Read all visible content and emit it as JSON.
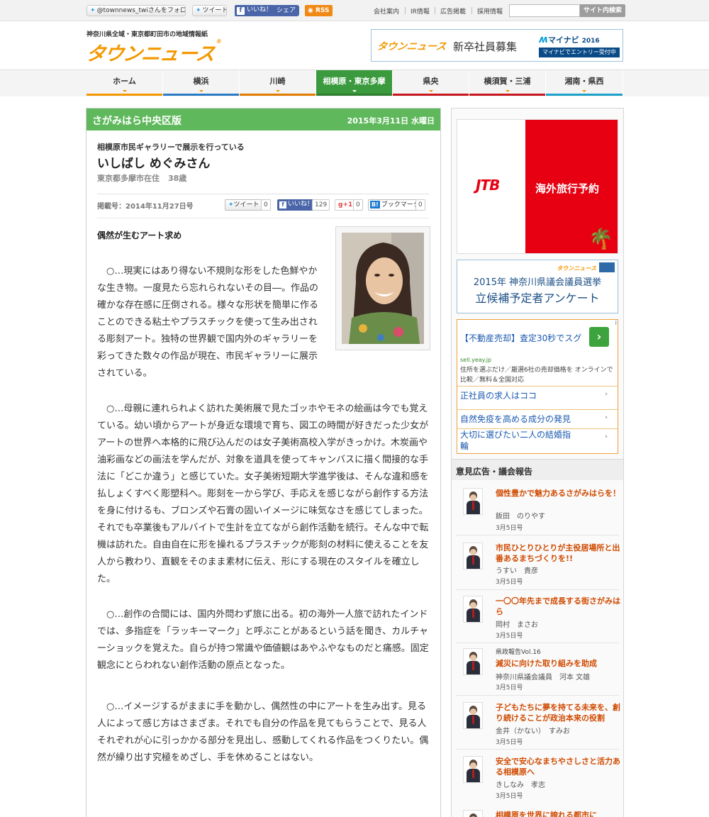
{
  "topbar": {
    "twitter_follow": "@townnews_twiさんをフォロー",
    "tweet": "ツイート",
    "like": "いいね！",
    "share": "シェア",
    "rss": "RSS",
    "links": [
      "会社案内",
      "IR情報",
      "広告掲載",
      "採用情報"
    ],
    "search_placeholder": "",
    "search_button": "サイト内検索"
  },
  "header": {
    "tagline": "神奈川県全域・東京都町田市の地域情報紙",
    "logo_text": "タウンニュース",
    "banner": {
      "logo": "タウンニュース",
      "text": "新卒社員募集",
      "mynavi": "マイナビ",
      "mynavi_year": "2016",
      "entry": "マイナビでエントリー受付中"
    }
  },
  "nav": {
    "items": [
      {
        "label": "ホーム",
        "color": "#f39800"
      },
      {
        "label": "横浜",
        "color": "#2a7bc4"
      },
      {
        "label": "川崎",
        "color": "#e07b00"
      },
      {
        "label": "相模原・東京多摩",
        "color": "#3a9a3d"
      },
      {
        "label": "県央",
        "color": "#c8161d"
      },
      {
        "label": "横須賀・三浦",
        "color": "#c8161d"
      },
      {
        "label": "湘南・県西",
        "color": "#1ba0c8"
      }
    ],
    "active_index": 3
  },
  "article": {
    "edition": "さがみはら中央区版",
    "date": "2015年3月11日 水曜日",
    "kicker": "相模原市民ギャラリーで展示を行っている",
    "title": "いしばし めぐみさん",
    "residence": "東京都多摩市在住",
    "age": "38歳",
    "issue": "掲載号：2014年11月27日号",
    "share": {
      "tweet": "ツイート",
      "tweet_count": "0",
      "like": "いいね！",
      "like_count": "129",
      "gplus": "g+1",
      "gplus_count": "0",
      "hatena": "ブックマーク",
      "hatena_count": "0"
    },
    "section_title": "偶然が生むアート求め",
    "paragraphs": [
      "○…現実にはあり得ない不規則な形をした色鮮やかな生き物。一度見たら忘れられないその目―。作品の確かな存在感に圧倒される。様々な形状を簡単に作ることのできる粘土やプラスチックを使って生み出される彫刻アート。独特の世界観で国内外のギャラリーを彩ってきた数々の作品が現在、市民ギャラリーに展示されている。",
      "○…母親に連れられよく訪れた美術展で見たゴッホやモネの絵画は今でも覚えている。幼い頃からアートが身近な環境で育ち、図工の時間が好きだった少女がアートの世界へ本格的に飛び込んだのは女子美術高校入学がきっかけ。木炭画や油彩画などの画法を学んだが、対象を道具を使ってキャンバスに描く間接的な手法に「どこか違う」と感じていた。女子美術短期大学進学後は、そんな違和感を払しょくすべく彫塑科へ。彫刻を一から学び、手応えを感じながら創作する方法を身に付けるも、ブロンズや石膏の固いイメージに味気なさを感じてしまった。それでも卒業後もアルバイトで生計を立てながら創作活動を続行。そんな中で転機は訪れた。自由自在に形を操れるプラスチックが彫刻の材料に使えることを友人から教わり、直観をそのまま素材に伝え、形にする現在のスタイルを確立した。",
      "○…創作の合間には、国内外問わず旅に出る。初の海外一人旅で訪れたインドでは、多指症を「ラッキーマーク」と呼ぶことがあるという話を聞き、カルチャーショックを覚えた。自らが持つ常識や価値観はあやふやなものだと痛感。固定観念にとらわれない創作活動の原点となった。",
      "○…イメージするがままに手を動かし、偶然性の中にアートを生み出す。見る人によって感じ方はさまざま。それでも自分の作品を見てもらうことで、見る人それぞれが心に引っかかる部分を見出し、感動してくれる作品をつくりたい。偶然が繰り出す究極をめざし、手を休めることはない。"
    ]
  },
  "sidebar": {
    "jtb": {
      "logo": "JTB",
      "text": "海外旅行予約"
    },
    "survey": {
      "logo": "タウンニュース",
      "line1": "2015年 神奈川県議会議員選挙",
      "line2": "立候補予定者アンケート"
    },
    "ads": {
      "info_icon": "i",
      "headline": "【不動産売却】査定30秒でスグ",
      "arrow": "›",
      "url": "sell.yeay.jp",
      "desc": "住所を選ぶだけ／厳選6社の売却価格を オンラインで比較／無料＆全国対応",
      "links": [
        "正社員の求人はココ",
        "自然免疫を高める成分の発見",
        "大切に選びたい二人の結婚指輪"
      ]
    },
    "opinion_title": "意見広告・議会報告",
    "opinion_items": [
      {
        "prefix": "",
        "title": "個性豊かで魅力あるさがみはらを！",
        "name": "飯田　のりやす",
        "date": "3月5日号"
      },
      {
        "prefix": "",
        "title": "市民ひとりひとりが主役居場所と出番あるまちづくりを!!",
        "name": "うすい　貴彦",
        "date": "3月5日号"
      },
      {
        "prefix": "",
        "title": "一〇〇年先まで成長する街さがみはら",
        "name": "岡村　まさお",
        "date": "3月5日号"
      },
      {
        "prefix": "県政報告Vol.16",
        "title": "減災に向けた取り組みを助成",
        "name": "神奈川県議会議員　河本 文雄",
        "date": "3月5日号"
      },
      {
        "prefix": "",
        "title": "子どもたちに夢を持てる未来を、創り続けることが政治本来の役割",
        "name": "金井（かない）　すみお",
        "date": "3月5日号"
      },
      {
        "prefix": "",
        "title": "安全で安心なまちやさしさと活力ある相模原へ",
        "name": "きしなみ　孝志",
        "date": "3月5日号"
      },
      {
        "prefix": "",
        "title": "相模原を世界に誇れる都市に",
        "name": "",
        "date": ""
      }
    ]
  }
}
